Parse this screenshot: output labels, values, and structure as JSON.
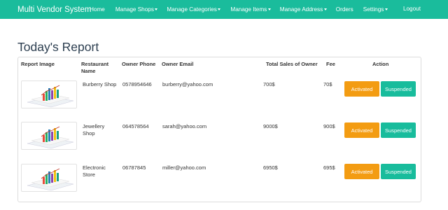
{
  "nav": {
    "brand": "Multi Vendor System",
    "items": [
      "Home",
      "Manage Shops",
      "Manage Categories",
      "Manage Items",
      "Manage Address",
      "Orders",
      "Settings"
    ],
    "logout": "Logout"
  },
  "page": {
    "title": "Today's Report"
  },
  "table": {
    "headers": {
      "image": "Report Image",
      "restaurant_line1": "Restaurant",
      "restaurant_line2": "Name",
      "phone": "Owner Phone",
      "email": "Owner Email",
      "sales": "Total Sales of Owner",
      "fee": "Fee",
      "action": "Action"
    },
    "rows": [
      {
        "name_line1": "Burberry Shop",
        "name_line2": "",
        "phone": "0578954646",
        "email": "burberry@yahoo.com",
        "sales": "700$",
        "fee": "70$"
      },
      {
        "name_line1": "Jewellery",
        "name_line2": "Shop",
        "phone": "064578564",
        "email": "sarah@yahoo.com",
        "sales": "9000$",
        "fee": "900$"
      },
      {
        "name_line1": "Electronic",
        "name_line2": "Store",
        "phone": "06787845",
        "email": "miller@yahoo.com",
        "sales": "6950$",
        "fee": "695$"
      }
    ],
    "activate_label": "Activated",
    "suspend_label": "Suspended"
  },
  "colors": {
    "navbar": "#1abc9c",
    "activate": "#f39c12",
    "suspend": "#18bc9c",
    "title": "#2c3e50"
  }
}
